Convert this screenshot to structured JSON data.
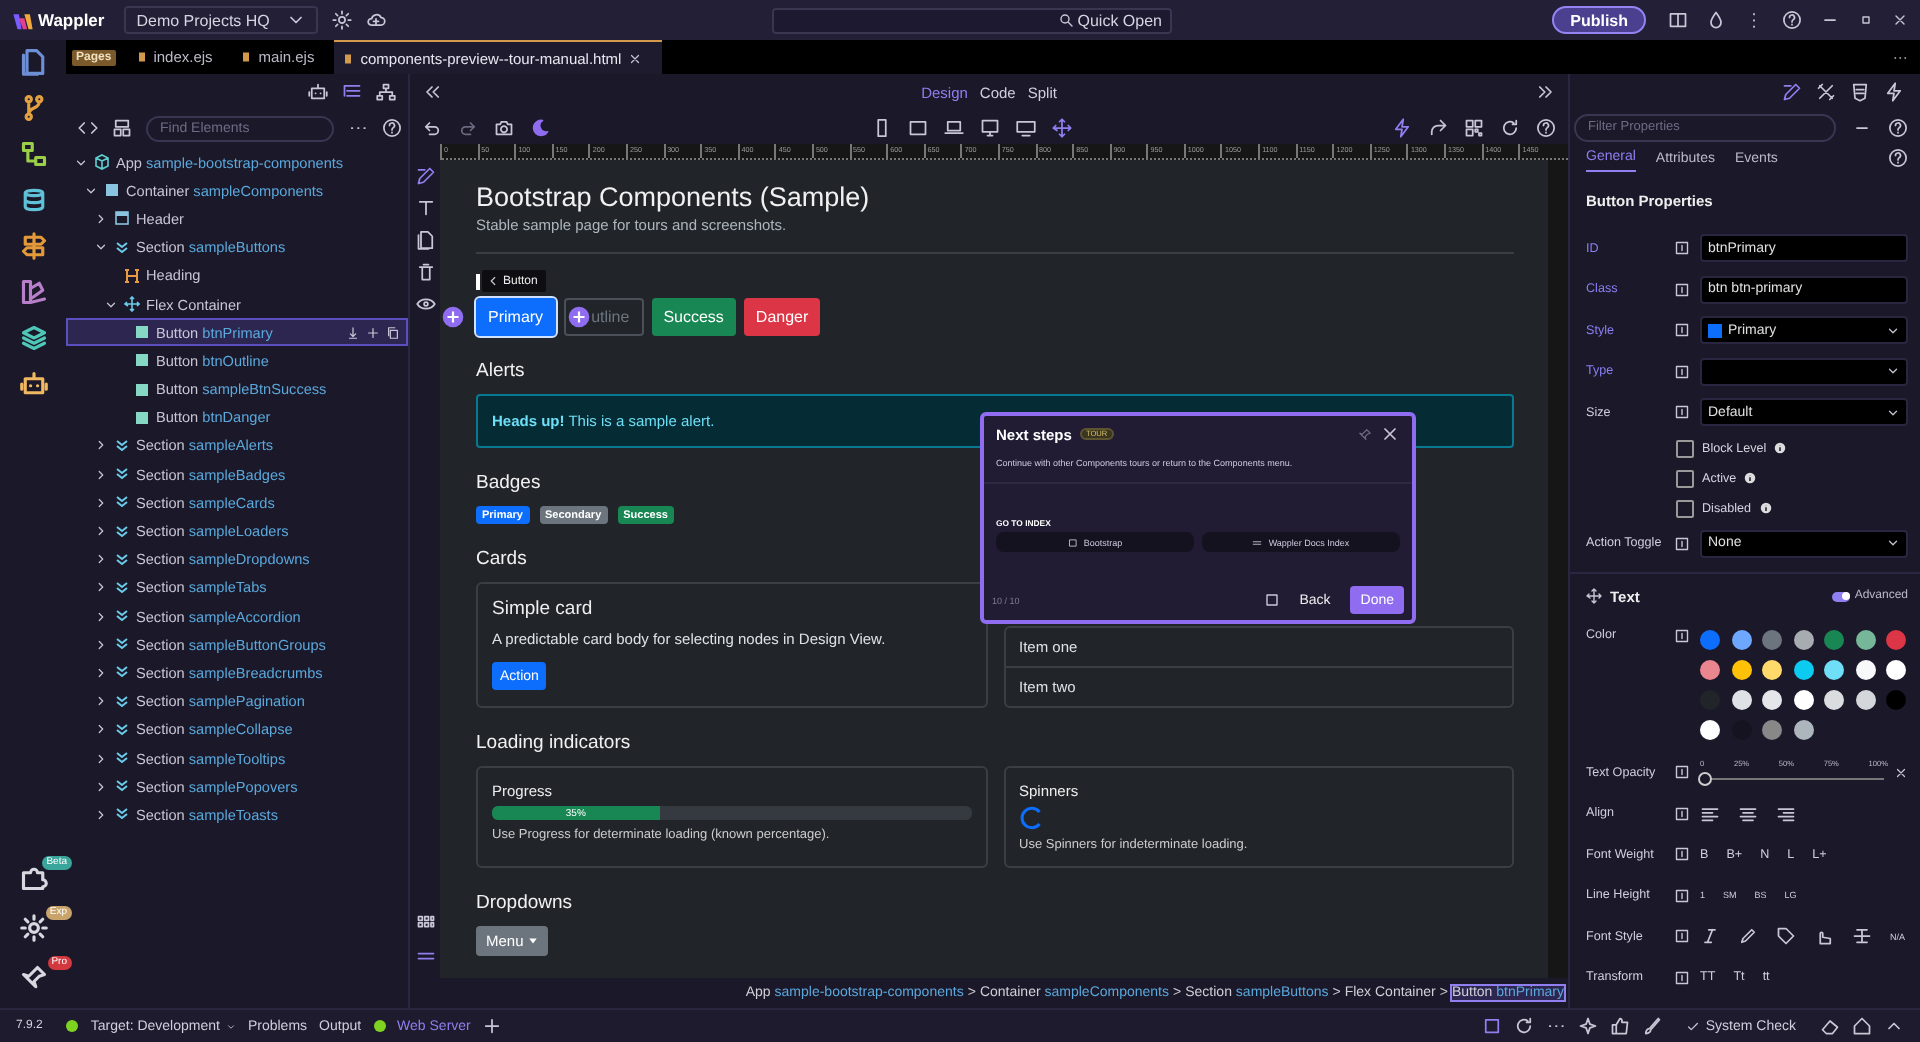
{
  "app_bar": {
    "logo": "Wappler",
    "project": "Demo Projects HQ",
    "quick_open": "Quick Open",
    "publish": "Publish"
  },
  "activity_bar": {
    "badges": [
      {
        "label": "Beta",
        "color": "#3aa59a"
      },
      {
        "label": "Exp",
        "color": "#c9a46a"
      },
      {
        "label": "Pro",
        "color": "#d2393f"
      }
    ]
  },
  "file_tabs": {
    "badge": "Pages",
    "tabs": [
      {
        "label": "index.ejs",
        "selected": false
      },
      {
        "label": "main.ejs",
        "selected": false
      },
      {
        "label": "components-preview--tour-manual.html",
        "selected": true
      }
    ]
  },
  "elements_panel": {
    "search_placeholder": "Find Elements",
    "tree": [
      {
        "kind": "app",
        "type": "App",
        "name": "sample-bootstrap-components",
        "expanded": true,
        "selected": false,
        "children": [
          {
            "kind": "container",
            "type": "Container",
            "name": "sampleComponents",
            "expanded": true,
            "selected": false,
            "children": [
              {
                "kind": "header",
                "type": "Header",
                "expanded": false,
                "selected": false
              },
              {
                "kind": "section",
                "type": "Section",
                "name": "sampleButtons",
                "expanded": true,
                "selected": false,
                "children": [
                  {
                    "kind": "heading",
                    "type": "Heading",
                    "selected": false
                  },
                  {
                    "kind": "flex",
                    "type": "Flex Container",
                    "expanded": true,
                    "selected": false,
                    "children": [
                      {
                        "kind": "button",
                        "type": "Button",
                        "name": "btnPrimary",
                        "selected": true
                      },
                      {
                        "kind": "button",
                        "type": "Button",
                        "name": "btnOutline",
                        "selected": false
                      },
                      {
                        "kind": "button",
                        "type": "Button",
                        "name": "sampleBtnSuccess",
                        "selected": false
                      },
                      {
                        "kind": "button",
                        "type": "Button",
                        "name": "btnDanger",
                        "selected": false
                      }
                    ]
                  }
                ]
              },
              {
                "kind": "section",
                "type": "Section",
                "name": "sampleAlerts",
                "expanded": false,
                "selected": false
              },
              {
                "kind": "section",
                "type": "Section",
                "name": "sampleBadges",
                "expanded": false,
                "selected": false
              },
              {
                "kind": "section",
                "type": "Section",
                "name": "sampleCards",
                "expanded": false,
                "selected": false
              },
              {
                "kind": "section",
                "type": "Section",
                "name": "sampleLoaders",
                "expanded": false,
                "selected": false
              },
              {
                "kind": "section",
                "type": "Section",
                "name": "sampleDropdowns",
                "expanded": false,
                "selected": false
              },
              {
                "kind": "section",
                "type": "Section",
                "name": "sampleTabs",
                "expanded": false,
                "selected": false
              },
              {
                "kind": "section",
                "type": "Section",
                "name": "sampleAccordion",
                "expanded": false,
                "selected": false
              },
              {
                "kind": "section",
                "type": "Section",
                "name": "sampleButtonGroups",
                "expanded": false,
                "selected": false
              },
              {
                "kind": "section",
                "type": "Section",
                "name": "sampleBreadcrumbs",
                "expanded": false,
                "selected": false
              },
              {
                "kind": "section",
                "type": "Section",
                "name": "samplePagination",
                "expanded": false,
                "selected": false
              },
              {
                "kind": "section",
                "type": "Section",
                "name": "sampleCollapse",
                "expanded": false,
                "selected": false
              },
              {
                "kind": "section",
                "type": "Section",
                "name": "sampleTooltips",
                "expanded": false,
                "selected": false
              },
              {
                "kind": "section",
                "type": "Section",
                "name": "samplePopovers",
                "expanded": false,
                "selected": false
              },
              {
                "kind": "section",
                "type": "Section",
                "name": "sampleToasts",
                "expanded": false,
                "selected": false
              }
            ]
          }
        ]
      }
    ]
  },
  "design_view": {
    "modes": [
      {
        "label": "Design",
        "selected": true
      },
      {
        "label": "Code",
        "selected": false
      },
      {
        "label": "Split",
        "selected": false
      }
    ],
    "ruler": [
      "0",
      "50",
      "100",
      "150",
      "200",
      "250",
      "300",
      "350",
      "400",
      "450",
      "500",
      "550",
      "600",
      "650",
      "700",
      "750",
      "800",
      "850",
      "900",
      "950",
      "1000",
      "1050",
      "1100",
      "1150",
      "1200",
      "1250",
      "1300",
      "1350",
      "1400",
      "1450"
    ]
  },
  "page": {
    "title": "Bootstrap Components (Sample)",
    "subtitle": "Stable sample page for tours and screenshots.",
    "selection_tag": "Button",
    "buttons": [
      {
        "label": "Primary",
        "selected": true
      },
      {
        "label": "utline",
        "selected": false
      },
      {
        "label": "Success",
        "selected": false
      },
      {
        "label": "Danger",
        "selected": false
      }
    ],
    "alerts": {
      "heading": "Alerts",
      "text": "**Heads up!** This is a sample alert."
    },
    "badges": {
      "heading": "Badges",
      "items": [
        "Primary",
        "Secondary",
        "Success"
      ]
    },
    "cards": {
      "heading": "Cards",
      "card": {
        "title": "Simple card",
        "text": "A predictable card body for selecting nodes in Design View.",
        "action": "Action"
      },
      "list": [
        "Item one",
        "Item two"
      ]
    },
    "loading": {
      "heading": "Loading indicators",
      "progress": {
        "title": "Progress",
        "level": 0.35,
        "label": "35%",
        "text": "Use Progress for determinate loading (known percentage)."
      },
      "spinners": {
        "title": "Spinners",
        "text": "Use Spinners for indeterminate loading."
      }
    },
    "dropdowns": {
      "heading": "Dropdowns",
      "button": "Menu"
    }
  },
  "tour_popover": {
    "title": "Next steps",
    "badge": "TOUR",
    "text": "Continue with other Components tours or return to the Components menu.",
    "section": "GO TO INDEX",
    "links": [
      "Bootstrap",
      "Wappler Docs Index"
    ],
    "step": "10 / 10",
    "back": "Back",
    "done": "Done"
  },
  "breadcrumb": {
    "separator": ">",
    "items": [
      {
        "type": "App",
        "name": "sample-bootstrap-components",
        "selected": false
      },
      {
        "type": "Container",
        "name": "sampleComponents",
        "selected": false
      },
      {
        "type": "Section",
        "name": "sampleButtons",
        "selected": false
      },
      {
        "type": "Flex Container",
        "selected": false
      },
      {
        "type": "Button",
        "name": "btnPrimary",
        "selected": true
      }
    ]
  },
  "properties": {
    "filter_placeholder": "Filter Properties",
    "tabs": [
      {
        "label": "General",
        "selected": true
      },
      {
        "label": "Attributes",
        "selected": false
      },
      {
        "label": "Events",
        "selected": false
      }
    ],
    "title": "Button Properties",
    "fields": [
      {
        "label": "ID",
        "kind": "input",
        "value": "btnPrimary",
        "modified": true
      },
      {
        "label": "Class",
        "kind": "input",
        "value": "btn btn-primary",
        "modified": true
      },
      {
        "label": "Style",
        "kind": "select",
        "value": "Primary",
        "modified": true
      },
      {
        "label": "Type",
        "kind": "select",
        "modified": true
      },
      {
        "label": "Size",
        "kind": "select",
        "value": "Default",
        "modified": false
      }
    ],
    "checkboxes": [
      {
        "label": "Block Level",
        "checked": false
      },
      {
        "label": "Active",
        "checked": false
      },
      {
        "label": "Disabled",
        "checked": false
      }
    ],
    "action_toggle": {
      "label": "Action Toggle",
      "value": "None"
    },
    "text_section": {
      "title": "Text",
      "advanced": {
        "label": "Advanced",
        "on": true
      },
      "color_label": "Color",
      "colors": [
        {
          "color": "#0d6efd"
        },
        {
          "color": "#6ea8fe"
        },
        {
          "color": "#6c757d"
        },
        {
          "color": "#a7acb1"
        },
        {
          "color": "#198754"
        },
        {
          "color": "#75b798"
        },
        {
          "color": "#dc3545"
        },
        {
          "color": "#ea868f"
        },
        {
          "color": "#ffc107"
        },
        {
          "color": "#ffda6a"
        },
        {
          "color": "#0dcaf0"
        },
        {
          "color": "#6edff6"
        },
        {
          "color": "#f8f9fa"
        },
        {
          "color": "#ffffff"
        },
        {
          "color": "#212529"
        },
        {
          "color": "#dee2e6"
        },
        {
          "color": "#e4e6e9"
        },
        {
          "color": "#ffffff"
        },
        {
          "color": "#dadde0"
        },
        {
          "color": "#d3d6da"
        },
        {
          "color": "#000000"
        },
        {
          "color": "#ffffff"
        },
        {
          "color": "#15131f"
        },
        {
          "color": "#888888"
        },
        {
          "color": "#adb5bd"
        }
      ],
      "opacity": {
        "label": "Text Opacity",
        "ticks": [
          "0",
          "25%",
          "50%",
          "75%",
          "100%"
        ],
        "level": 0
      },
      "align_label": "Align",
      "font_weight": {
        "label": "Font Weight",
        "options": [
          "B",
          "B+",
          "N",
          "L",
          "L+"
        ]
      },
      "line_height": {
        "label": "Line Height",
        "options": [
          "1",
          "SM",
          "BS",
          "LG"
        ]
      },
      "font_style": {
        "label": "Font Style",
        "option": "N/A"
      },
      "transform": {
        "label": "Transform",
        "options": [
          "TT",
          "Tt",
          "tt"
        ]
      }
    }
  },
  "status_bar": {
    "version": "7.9.2",
    "target": "Target: Development",
    "problems": "Problems",
    "output": "Output",
    "server": "Web Server",
    "system_check": "System Check"
  }
}
